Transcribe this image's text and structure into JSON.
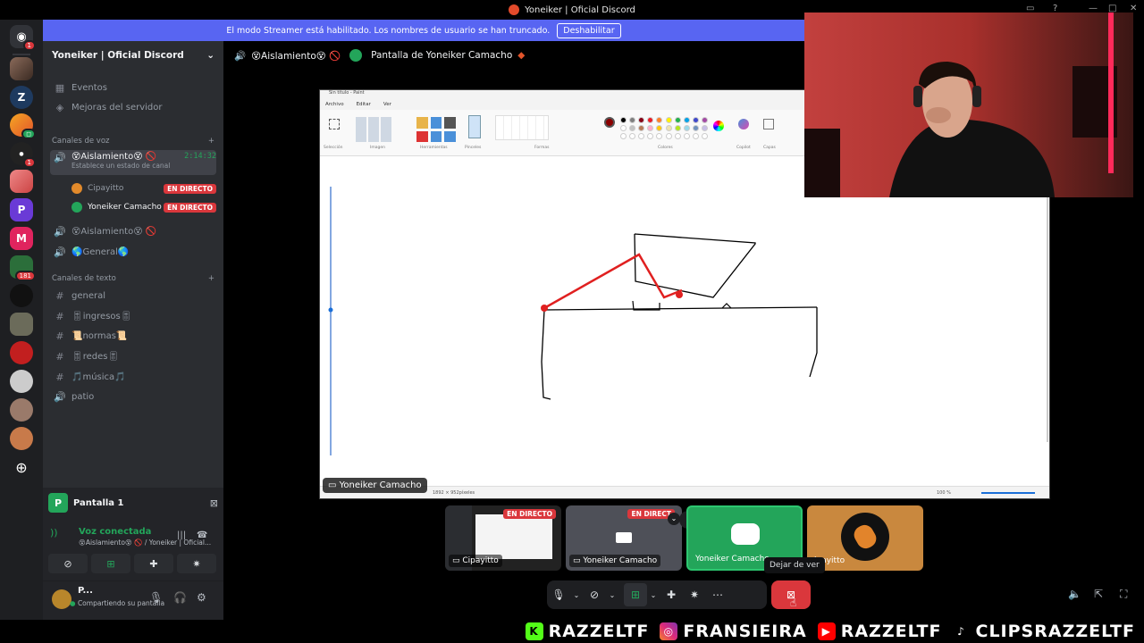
{
  "window": {
    "title": "Yoneiker | Oficial Discord"
  },
  "banner": {
    "text": "El modo Streamer está habilitado. Los nombres de usuario se han truncado.",
    "button": "Deshabilitar"
  },
  "rail": {
    "badges": [
      "1",
      "1",
      "1",
      "181"
    ]
  },
  "sidebar": {
    "server_name": "Yoneiker | Oficial Discord",
    "links": [
      "Eventos",
      "Mejoras del servidor"
    ],
    "voice_category": "Canales de voz",
    "voice_channels": [
      {
        "name": "😵Aislamiento😵 🚫",
        "sub": "Establece un estado de canal",
        "timer": "2:14:32"
      },
      {
        "name": "😵Aislamiento😵 🚫"
      },
      {
        "name": "🌎General🌎"
      }
    ],
    "members": [
      {
        "name": "Cipayitto",
        "status": "EN DIRECTO"
      },
      {
        "name": "Yoneiker Camacho",
        "status": "EN DIRECTO"
      }
    ],
    "text_category": "Canales de texto",
    "text_channels": [
      "general",
      "🎚ingresos🎚",
      "📜normas📜",
      "🎚redes🎚",
      "🎵música🎵",
      "patio"
    ]
  },
  "voice_panel": {
    "screen_title": "Pantalla 1",
    "status": "Voz conectada",
    "location": "😵Aislamiento😵 🚫 / Yoneiker | Oficial...",
    "user_name": "P...",
    "user_status": "Compartiendo su pantalla"
  },
  "main_header": {
    "channel": "😵Aislamiento😵 🚫",
    "stream": "Pantalla de Yoneiker Camacho"
  },
  "paint": {
    "title": "Sin título - Paint",
    "menu": [
      "Archivo",
      "Editar",
      "Ver"
    ],
    "groups": [
      "Selección",
      "Imagen",
      "Herramientas",
      "Pinceles",
      "Formas",
      "Colores",
      "Copilot",
      "Capas"
    ],
    "status_size": "1892 × 952píxeles",
    "zoom": "100 %"
  },
  "screen_label": "Yoneiker Camacho",
  "tiles": [
    {
      "name": "Cipayitto",
      "live": "EN DIRECTO"
    },
    {
      "name": "Yoneiker Camacho",
      "live": "EN DIRECT"
    },
    {
      "name": "Yoneiker Camacho"
    },
    {
      "name": "ipayitto"
    }
  ],
  "tooltip": "Dejar de ver",
  "overlay": [
    "RAZZELTF",
    "FRANSIEIRA",
    "RAZZELTF",
    "CLIPSRAZZELTF"
  ],
  "colors": {
    "blurple": "#5865f2",
    "live_red": "#da373c",
    "green": "#23a55a",
    "sidebar": "#2b2d31",
    "rail": "#1e1f22"
  }
}
